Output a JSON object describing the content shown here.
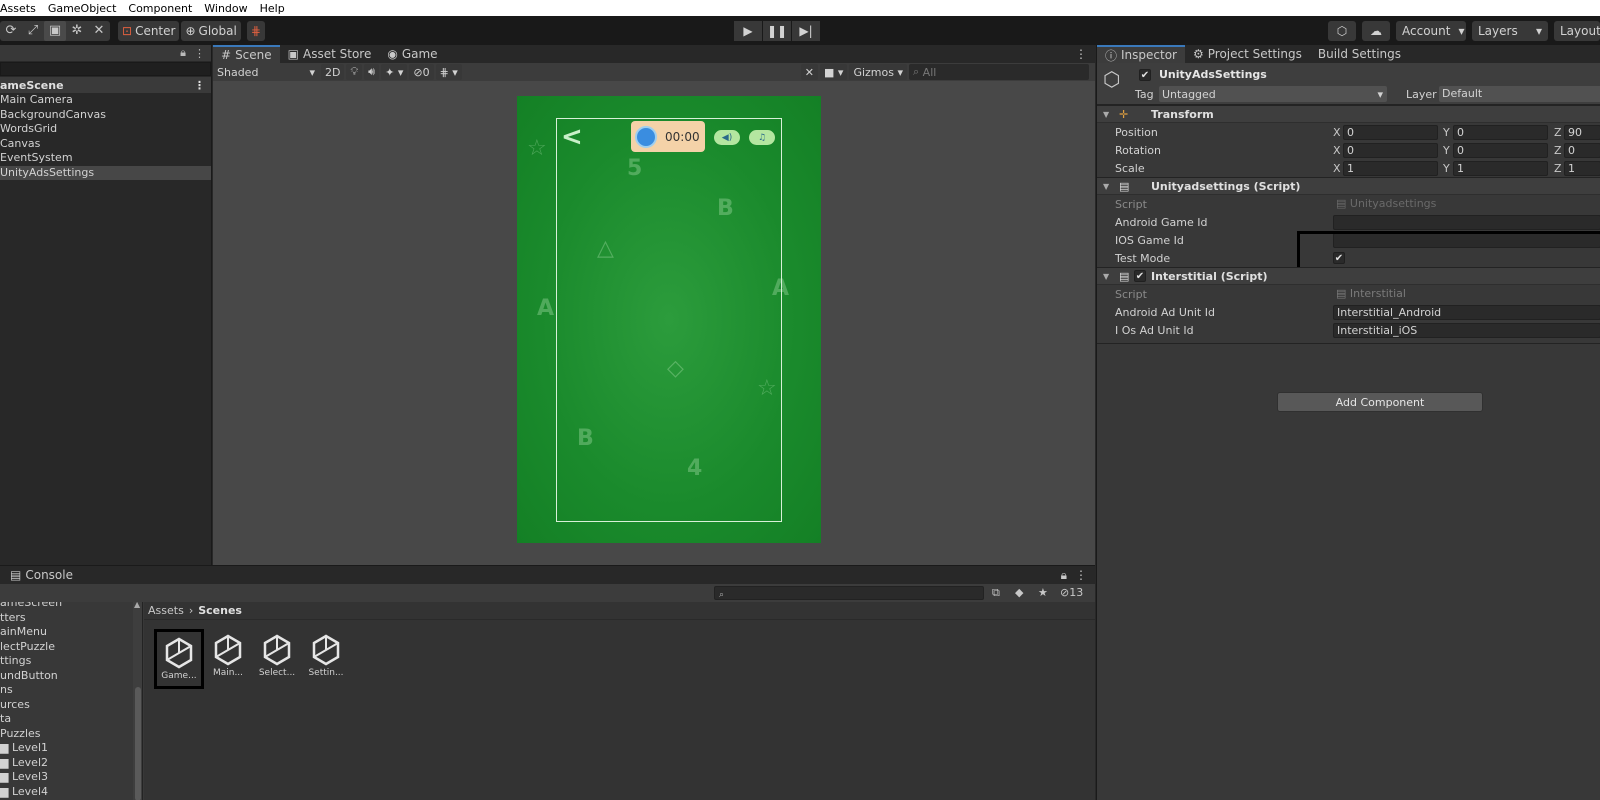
{
  "menubar": [
    "Assets",
    "GameObject",
    "Component",
    "Window",
    "Help"
  ],
  "toolbar": {
    "pivot": "Center",
    "space": "Global",
    "right": {
      "account": "Account",
      "layers": "Layers",
      "layout": "Layout"
    }
  },
  "hierarchy": {
    "scene": "ameScene",
    "items": [
      "Main Camera",
      "BackgroundCanvas",
      "WordsGrid",
      "Canvas",
      "EventSystem",
      "UnityAdsSettings"
    ],
    "selected_index": 5
  },
  "scene_panel": {
    "tabs": [
      "Scene",
      "Asset Store",
      "Game"
    ],
    "shading": "Shaded",
    "mode_2d": "2D",
    "hidden_count": "0",
    "gizmos": "Gizmos",
    "search_placeholder": "All",
    "game": {
      "timer": "00:00"
    }
  },
  "inspector": {
    "tabs": [
      "Inspector",
      "Project Settings",
      "Build Settings"
    ],
    "object_name": "UnityAdsSettings",
    "tag_label": "Tag",
    "tag_value": "Untagged",
    "layer_label": "Layer",
    "layer_value": "Default",
    "transform": {
      "title": "Transform",
      "position": {
        "label": "Position",
        "x": "0",
        "y": "0",
        "z": "90"
      },
      "rotation": {
        "label": "Rotation",
        "x": "0",
        "y": "0",
        "z": "0"
      },
      "scale": {
        "label": "Scale",
        "x": "1",
        "y": "1",
        "z": "1"
      }
    },
    "ads_script": {
      "title": "Unityadsettings (Script)",
      "script_label": "Script",
      "script_value": "Unityadsettings",
      "android_label": "Android Game Id",
      "android_value": "",
      "ios_label": "IOS Game Id",
      "ios_value": "",
      "test_label": "Test Mode"
    },
    "interstitial": {
      "title": "Interstitial (Script)",
      "script_label": "Script",
      "script_value": "Interstitial",
      "android_label": "Android Ad Unit Id",
      "android_value": "Interstitial_Android",
      "ios_label": "I Os Ad Unit Id",
      "ios_value": "Interstitial_iOS"
    },
    "add_component": "Add Component"
  },
  "project": {
    "tabs": [
      "Console"
    ],
    "hidden_count": "13",
    "tree": [
      "ameScreen",
      "tters",
      "ainMenu",
      "lectPuzzle",
      "ttings",
      "undButton",
      "ns",
      "urces",
      "ta",
      "Puzzles",
      "Level1",
      "Level2",
      "Level3",
      "Level4"
    ],
    "breadcrumb": {
      "root": "Assets",
      "current": "Scenes"
    },
    "assets": [
      "Game...",
      "Main...",
      "Select...",
      "Settin..."
    ]
  }
}
